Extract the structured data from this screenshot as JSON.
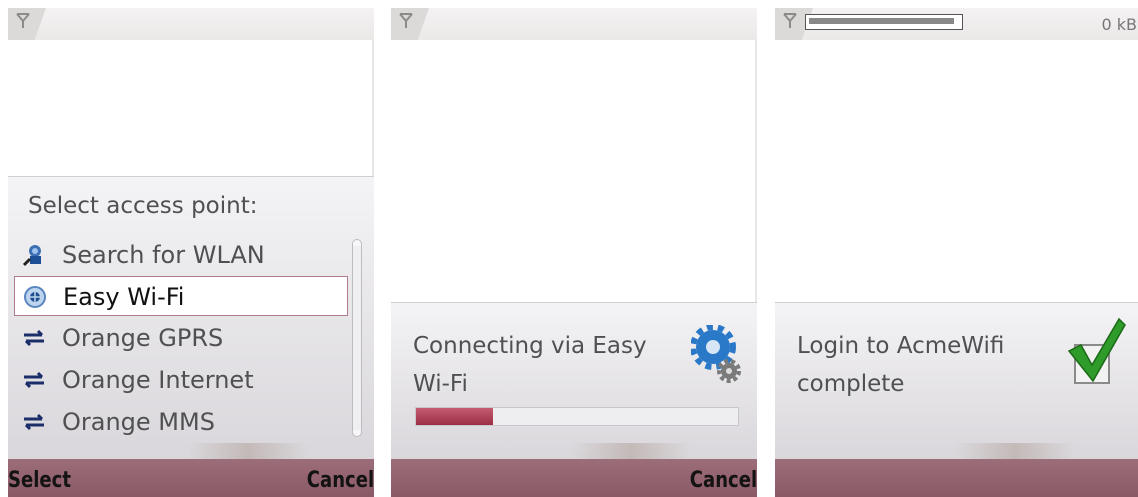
{
  "screens": [
    {
      "status": {
        "icon": "signal-antenna-icon"
      },
      "popup": {
        "title": "Select access point:",
        "items": [
          {
            "label": "Search for WLAN",
            "icon": "wlan-search-icon",
            "selected": false
          },
          {
            "label": "Easy Wi-Fi",
            "icon": "easy-wifi-icon",
            "selected": true
          },
          {
            "label": "Orange GPRS",
            "icon": "packet-data-arrows-icon",
            "selected": false
          },
          {
            "label": "Orange Internet",
            "icon": "packet-data-arrows-icon",
            "selected": false
          },
          {
            "label": "Orange MMS",
            "icon": "packet-data-arrows-icon",
            "selected": false
          }
        ]
      },
      "softkeys": {
        "left": "Select",
        "right": "Cancel"
      }
    },
    {
      "status": {
        "icon": "signal-antenna-icon"
      },
      "popup": {
        "message": "Connecting via Easy Wi-Fi",
        "icon": "gears-icon",
        "progress": 0.24,
        "progress_color": "#a93850"
      },
      "softkeys": {
        "left": "",
        "right": "Cancel"
      }
    },
    {
      "status": {
        "icon": "signal-antenna-icon",
        "download_progress": 0.97,
        "size": "0 kB"
      },
      "popup": {
        "message": "Login to AcmeWifi complete",
        "icon": "checkmark-icon"
      },
      "softkeys": {
        "left": "",
        "right": ""
      }
    }
  ],
  "colors": {
    "softkey_bar": "#8f5e6b",
    "selection_border": "#b07b8a",
    "text": "#505052"
  }
}
